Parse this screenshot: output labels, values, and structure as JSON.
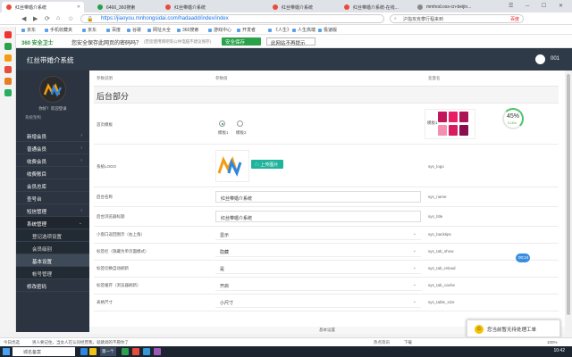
{
  "browser": {
    "tabs": [
      {
        "label": "红丝带婚介系统"
      },
      {
        "label": "6466_360搜索"
      },
      {
        "label": "红丝带婚介系统"
      },
      {
        "label": "红丝带婚介系统"
      },
      {
        "label": "红丝带婚介系统-在线..."
      },
      {
        "label": "mmhod.oss-cn-beijin..."
      }
    ],
    "url": "https://jiaoyou.mnhongsidai.com/hadaadd/index/index",
    "search_text": "沪指攻克攀行程来到",
    "search_brand": "百度",
    "bookmarks": [
      "京东",
      "手机收藏夹",
      "京东",
      "百度",
      "谷歌",
      "网址大全",
      "360搜索",
      "游戏中心",
      "开发者",
      "《人生》",
      "人生高端",
      "极速版"
    ],
    "password_bar": {
      "logo": "360 安全卫士",
      "question": "您安全保存此网页的密码吗？",
      "note": "(若您使用网吧等公共电脑不建议保存)",
      "save": "安全保存",
      "never": "此网站不再提示"
    }
  },
  "app": {
    "title": "红丝带婚介系统",
    "user": "001",
    "sidebar": {
      "hello": "你好！欢迎登录",
      "sub": "系统架构",
      "items": [
        {
          "label": "新增会员"
        },
        {
          "label": "普通会员"
        },
        {
          "label": "收费会员"
        },
        {
          "label": "收费账目"
        },
        {
          "label": "会员总库"
        },
        {
          "label": "查号台"
        },
        {
          "label": "短信管理"
        },
        {
          "label": "系统管理"
        }
      ],
      "subitems": [
        {
          "label": "登记选项设置"
        },
        {
          "label": "会员级别"
        },
        {
          "label": "基本设置"
        },
        {
          "label": "帐号管理"
        }
      ],
      "last": "修改密码"
    },
    "table": {
      "headers": [
        "参数说明",
        "参数值",
        "变量名"
      ],
      "section": "后台部分",
      "rows": [
        {
          "label": "首页模板",
          "var": "",
          "radio1": "模板1",
          "radio2": "模板2",
          "thumb_label": "模板1"
        },
        {
          "label": "系统LOGO",
          "var": "sys_logo",
          "upload": "上传图片"
        },
        {
          "label": "后台名称",
          "value": "红丝带婚介系统",
          "var": "sys_name"
        },
        {
          "label": "后台浏览器标题",
          "value": "红丝带婚介系统",
          "var": "sys_title"
        },
        {
          "label": "小窗口返回图示（右上角）",
          "value": "显示",
          "var": "sys_backtips"
        },
        {
          "label": "标签栏（隐藏为单页面模式）",
          "value": "隐藏",
          "var": "sys_tab_show"
        },
        {
          "label": "标签切换自动刷新",
          "value": "是",
          "var": "sys_tab_reload"
        },
        {
          "label": "标签缓存（浏览器刷新）",
          "value": "开启",
          "var": "sys_tab_cache"
        },
        {
          "label": "表格尺寸",
          "value": "小尺寸",
          "var": "sys_table_size"
        }
      ]
    },
    "gauge": {
      "percent": "45%",
      "speed": "0.1K/s"
    },
    "badge": "00:24",
    "footer": "基本设置",
    "chat": "您当前暂无待处理工单"
  },
  "status_bar": {
    "left": "今日优选",
    "news": "男人要记住，当女人在认同经营我，就跳调的不愿你了",
    "right1": "热点资讯",
    "right2": "下载",
    "zoom": "100%"
  },
  "taskbar": {
    "search": "城名备案",
    "active": "第一个",
    "time": "10:42"
  }
}
